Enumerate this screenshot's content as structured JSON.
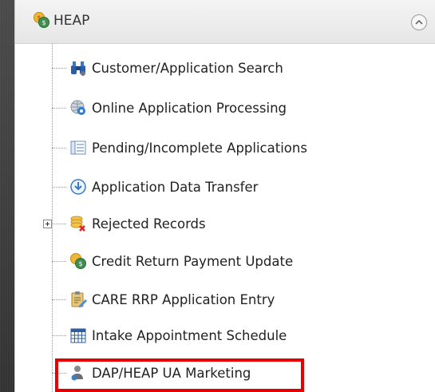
{
  "header": {
    "title": "HEAP"
  },
  "menu_items": [
    {
      "label": "Customer/Application Search",
      "icon": "binoculars-icon"
    },
    {
      "label": "Online Application Processing",
      "icon": "globe-gear-icon"
    },
    {
      "label": "Pending/Incomplete Applications",
      "icon": "document-list-icon"
    },
    {
      "label": "Application Data Transfer",
      "icon": "download-circle-icon"
    },
    {
      "label": "Rejected Records",
      "icon": "coins-reject-icon"
    },
    {
      "label": "Credit Return Payment Update",
      "icon": "coin-refund-icon"
    },
    {
      "label": "CARE RRP Application Entry",
      "icon": "clipboard-edit-icon"
    },
    {
      "label": "Intake Appointment Schedule",
      "icon": "calendar-grid-icon"
    },
    {
      "label": "DAP/HEAP UA Marketing",
      "icon": "person-marketing-icon"
    }
  ],
  "colors": {
    "highlight": "#e60000"
  }
}
